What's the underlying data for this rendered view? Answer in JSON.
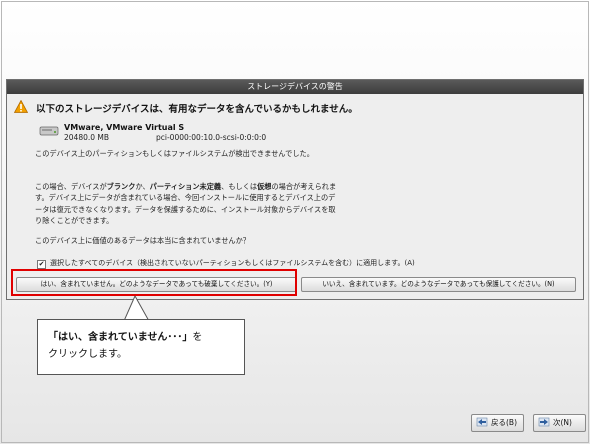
{
  "dialog": {
    "title": "ストレージデバイスの警告",
    "heading": "以下のストレージデバイスは、有用なデータを含んでいるかもしれません。",
    "device": {
      "name": "VMware, VMware Virtual S",
      "size": "20480.0 MB",
      "path": "pci-0000:00:10.0-scsi-0:0:0:0"
    },
    "para1": "このデバイス上のパーティションもしくはファイルシステムが検出できませんでした。",
    "para2": {
      "t1": "この場合、デバイスが",
      "b1": "ブランク",
      "t2": "か、",
      "b2": "パーティション未定義",
      "t3": "、もしくは",
      "b3": "仮想",
      "t4": "の場合が考えられます。デバイス上にデータが含まれている場合、今回インストールに使用するとデバイス上のデータは復元できなくなります。データを保護するために、インストール対象からデバイスを取り除くことができます。"
    },
    "para3": "このデバイス上に価値のあるデータは本当に含まれていませんか？",
    "checkbox_label": "選択したすべてのデバイス（検出されていないパーティションもしくはファイルシステムを含む）に適用します。(A)",
    "checkbox_checked": true,
    "yes_button": "はい、含まれていません。どのようなデータであっても破棄してください。(Y)",
    "no_button": "いいえ、含まれています。どのようなデータであっても保護してください。(N)"
  },
  "callout": {
    "line1_bold": "「はい、含まれていません･･･」",
    "line1_rest": "を",
    "line2": "クリックします。"
  },
  "nav": {
    "back_label": "戻る(B)",
    "next_label": "次(N)"
  },
  "colors": {
    "highlight": "#e00000",
    "title_bar": "#4a4a4a",
    "warning": "#f2a000"
  },
  "icons": [
    "warning-icon",
    "disk-icon",
    "back-arrow-icon",
    "next-arrow-icon"
  ]
}
